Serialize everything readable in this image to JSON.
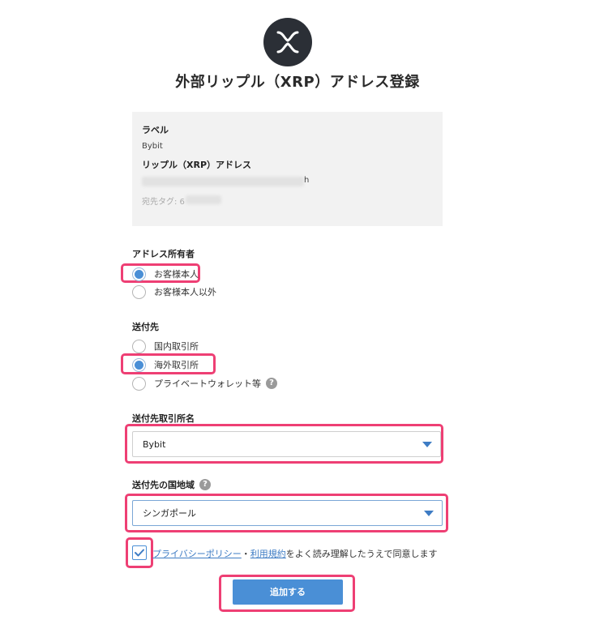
{
  "header": {
    "logo_icon": "xrp-logo-icon",
    "title": "外部リップル（XRP）アドレス登録"
  },
  "info": {
    "label_heading": "ラベル",
    "label_value": "Bybit",
    "address_heading": "リップル（XRP）アドレス",
    "address_suffix": "h",
    "tag_prefix": "宛先タグ: 6"
  },
  "owner": {
    "title": "アドレス所有者",
    "options": [
      {
        "label": "お客様本人",
        "checked": true
      },
      {
        "label": "お客様本人以外",
        "checked": false
      }
    ]
  },
  "destination": {
    "title": "送付先",
    "options": [
      {
        "label": "国内取引所",
        "checked": false
      },
      {
        "label": "海外取引所",
        "checked": true
      },
      {
        "label": "プライベートウォレット等",
        "checked": false,
        "help_icon": "?"
      }
    ]
  },
  "exchange": {
    "title": "送付先取引所名",
    "value": "Bybit"
  },
  "country": {
    "title": "送付先の国地域",
    "help_icon": "?",
    "value": "シンガポール"
  },
  "agreement": {
    "checked": true,
    "privacy_link": "プライバシーポリシー",
    "separator": "・",
    "terms_link": "利用規約",
    "rest_text": "をよく読み理解したうえで同意します"
  },
  "submit": {
    "label": "追加する"
  },
  "colors": {
    "accent": "#4a8fd6",
    "highlight": "#ee3f74",
    "panel": "#f2f2f2"
  }
}
